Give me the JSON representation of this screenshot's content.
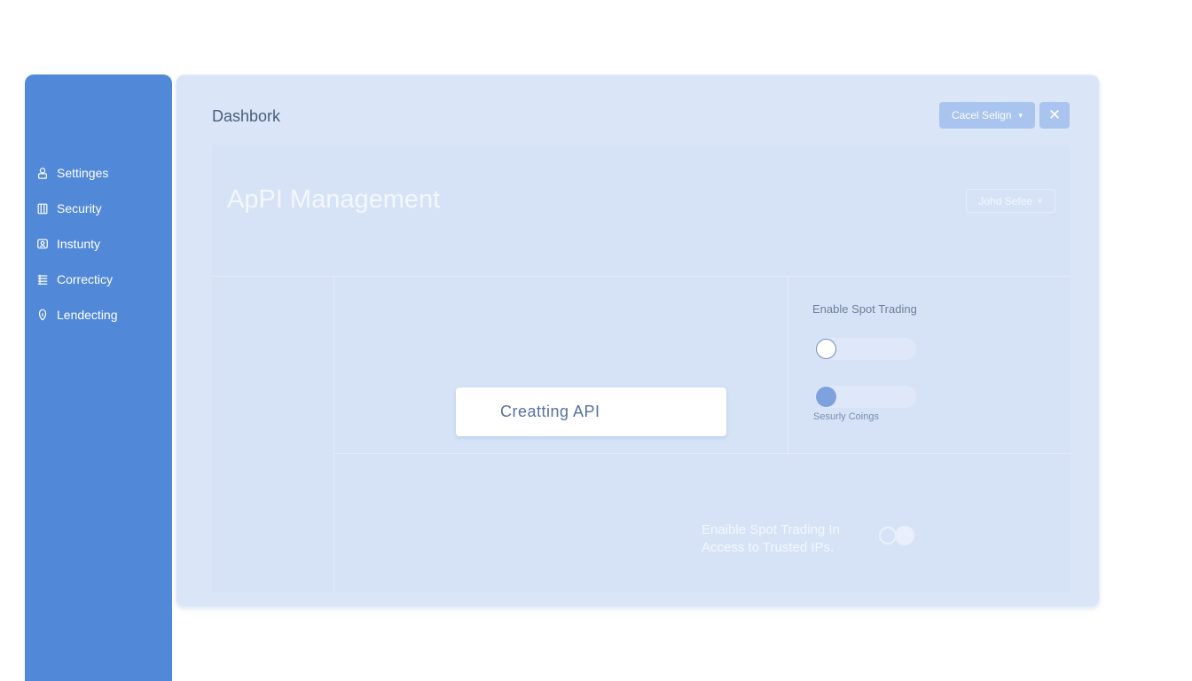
{
  "sidebar": {
    "items": [
      {
        "label": "Settinges",
        "icon": "user-lock-icon"
      },
      {
        "label": "Security",
        "icon": "clipboard-icon"
      },
      {
        "label": "Instunty",
        "icon": "id-card-icon"
      },
      {
        "label": "Correcticy",
        "icon": "list-icon"
      },
      {
        "label": "Lendecting",
        "icon": "shield-icon"
      }
    ]
  },
  "header": {
    "title": "Dashbork",
    "select_label": "Cacel Selign",
    "close_symbol": "✕"
  },
  "card": {
    "title": "ApPI Management",
    "select_label": "Johd Sefee"
  },
  "main": {
    "create_button_label": "Creatting API"
  },
  "settings": {
    "spot_trading_label": "Enable Spot Trading",
    "toggle_1_on": false,
    "toggle_2_on": true,
    "security_label": "Sesurly Coings",
    "bottom_text_line1": "Enaible Spot Trading In",
    "bottom_text_line2": "Access to Trusted IPs."
  },
  "colors": {
    "sidebar": "#5189d8",
    "panel": "#dae6f8",
    "accent": "#a9c4ef",
    "toggle_knob_active": "#7da2dd"
  }
}
